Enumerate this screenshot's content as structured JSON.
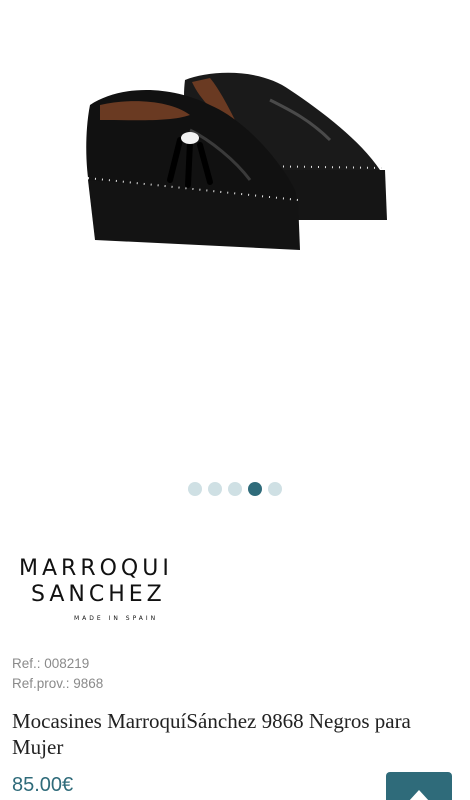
{
  "gallery": {
    "image_alt": "Black patent leather loafers with tassels and studs",
    "dots_count": 5,
    "active_dot": 4
  },
  "brand": {
    "line1": "MARROQUI",
    "line2": "SANCHEZ",
    "tagline": "MADE IN SPAIN"
  },
  "product": {
    "ref": "Ref.: 008219",
    "ref_prov": "Ref.prov.: 9868",
    "title": "Mocasines MarroquíSánchez 9868 Negros para Mujer",
    "price": "85.00€"
  },
  "colors": {
    "accent": "#2f6b7a",
    "dot_inactive": "#cfe0e4"
  },
  "icons": {
    "scroll_top": "chevron-up-icon"
  }
}
